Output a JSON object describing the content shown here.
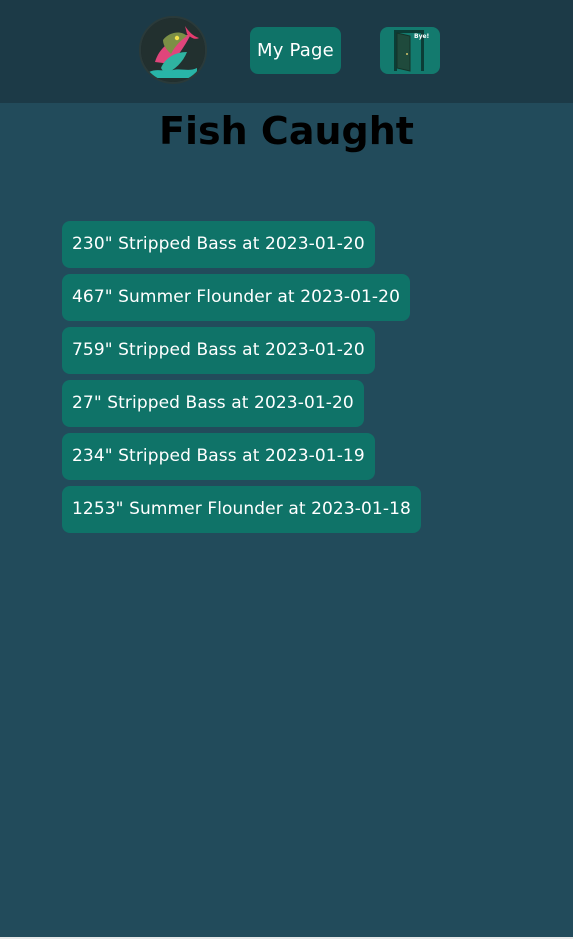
{
  "header": {
    "nav_label": "My Page",
    "logout_label": "Bye!"
  },
  "page": {
    "title": "Fish Caught"
  },
  "catches": [
    {
      "text": "230\" Stripped Bass at 2023-01-20"
    },
    {
      "text": "467\" Summer Flounder at 2023-01-20"
    },
    {
      "text": "759\" Stripped Bass at 2023-01-20"
    },
    {
      "text": "27\" Stripped Bass at 2023-01-20"
    },
    {
      "text": "234\" Stripped Bass at 2023-01-19"
    },
    {
      "text": "1253\" Summer Flounder at 2023-01-18"
    }
  ],
  "icons": {
    "logo": "fish-logo-icon",
    "logout": "door-icon"
  },
  "colors": {
    "background": "#224b5b",
    "header": "#1c3a47",
    "button": "#0f7368",
    "title": "#000000"
  }
}
